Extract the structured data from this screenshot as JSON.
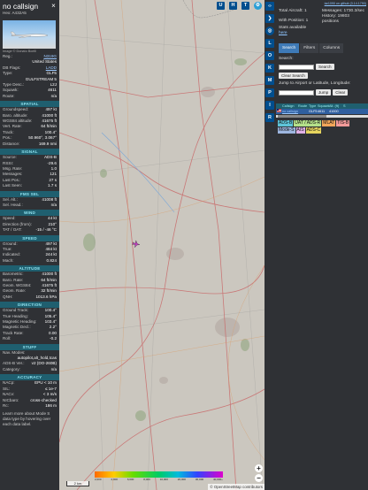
{
  "aircraft": {
    "callsign": "no callsign",
    "hex": "Hex: A432A5",
    "photo_credit": "Image © Donato Boelli",
    "details": [
      {
        "k": "Reg.:",
        "v": "N319G",
        "link": true
      },
      {
        "k": "",
        "v": "United States"
      },
      {
        "k": "DB Flags:",
        "v": "LADD",
        "link": true
      },
      {
        "k": "Type:",
        "v": "GLF5"
      },
      {
        "k": "",
        "v": "GULFSTREAM 5"
      },
      {
        "k": "Type Desc.:",
        "v": "L2J"
      },
      {
        "k": "Squawk:",
        "v": "4611"
      },
      {
        "k": "Route:",
        "v": "n/a"
      }
    ],
    "sections": [
      {
        "title": "SPATIAL",
        "rows": [
          {
            "k": "Groundspeed:",
            "v": "497 kt"
          },
          {
            "k": "Baro. altitude:",
            "v": "41000 ft"
          },
          {
            "k": "WGS84 altitude:",
            "v": "41675 ft"
          },
          {
            "k": "Vert. Rate:",
            "v": "64 ft/min"
          },
          {
            "k": "Track:",
            "v": "100.4°"
          },
          {
            "k": "Pos.:",
            "v": "50.960°, 3.067°"
          },
          {
            "k": "Distance:",
            "v": "169.9 nmi"
          }
        ]
      },
      {
        "title": "SIGNAL",
        "rows": [
          {
            "k": "Source:",
            "v": "ADS-B"
          },
          {
            "k": "RSSI:",
            "v": "-29.6"
          },
          {
            "k": "Msg. Rate:",
            "v": "1.0"
          },
          {
            "k": "Messages:",
            "v": "121"
          },
          {
            "k": "Last Pos.:",
            "v": "27 s"
          },
          {
            "k": "Last Seen:",
            "v": "1.7 s"
          }
        ]
      },
      {
        "title": "FMS SEL",
        "rows": [
          {
            "k": "Sel. Alt.:",
            "v": "41008 ft"
          },
          {
            "k": "Sel. Head.:",
            "v": "n/a"
          }
        ]
      },
      {
        "title": "WIND",
        "rows": [
          {
            "k": "Speed:",
            "v": "44 kt"
          },
          {
            "k": "Direction (from):",
            "v": "210°"
          },
          {
            "k": "TAT / OAT:",
            "v": "-15 / -46 °C"
          }
        ]
      },
      {
        "title": "SPEED",
        "rows": [
          {
            "k": "Ground:",
            "v": "497 kt"
          },
          {
            "k": "True:",
            "v": "484 kt"
          },
          {
            "k": "Indicated:",
            "v": "244 kt"
          },
          {
            "k": "Mach:",
            "v": "0.824"
          }
        ]
      },
      {
        "title": "ALTITUDE",
        "rows": [
          {
            "k": "Barometric:",
            "v": "41000 ft"
          },
          {
            "k": "Baro. Rate:",
            "v": "64 ft/min"
          },
          {
            "k": "Geom. WGS84:",
            "v": "41675 ft"
          },
          {
            "k": "Geom. Rate:",
            "v": "32 ft/min"
          },
          {
            "k": "QNH:",
            "v": "1013.6 hPa"
          }
        ]
      },
      {
        "title": "DIRECTION",
        "rows": [
          {
            "k": "Ground Track:",
            "v": "100.4°"
          },
          {
            "k": "True Heading:",
            "v": "105.4°"
          },
          {
            "k": "Magnetic Heading:",
            "v": "103.4°"
          },
          {
            "k": "Magnetic Decl.:",
            "v": "2.2°"
          },
          {
            "k": "Track Rate:",
            "v": "0.00"
          },
          {
            "k": "Roll:",
            "v": "-0.2"
          }
        ]
      },
      {
        "title": "STUFF",
        "rows": [
          {
            "k": "Nav. Modes:",
            "v": ""
          },
          {
            "k": "",
            "v": "autopilot,alt_hold,tcas"
          },
          {
            "k": "ADS-B Ver.:",
            "v": "v2 (DO-260B)"
          },
          {
            "k": "Category:",
            "v": "n/a"
          }
        ]
      },
      {
        "title": "ACCURACY",
        "rows": [
          {
            "k": "NACp:",
            "v": "EPU < 10 m"
          },
          {
            "k": "SIL:",
            "v": "≤ 1e-7"
          },
          {
            "k": "NACv:",
            "v": "< 3 m/s"
          },
          {
            "k": "NICbaro:",
            "v": "cross-checked"
          },
          {
            "k": "Rc:",
            "v": "186 m"
          }
        ]
      }
    ],
    "footer": "Learn more about Mode S data type by hovering over each data label."
  },
  "map": {
    "top_buttons": [
      "U",
      "H",
      "T"
    ],
    "zoom_in": "+",
    "zoom_out": "−",
    "scale": "2 km",
    "attribution": "© OpenStreetMap contributors",
    "alt_ticks": [
      "2,000",
      "4,000",
      "6,000",
      "8,000",
      "10,000",
      "20,000",
      "30,000",
      "40,000+"
    ]
  },
  "side_buttons": [
    "L",
    "O",
    "K",
    "M",
    "P",
    "I",
    "R"
  ],
  "panel": {
    "top_link": "tar1090 on github (3.14.1790)",
    "stats": {
      "total_aircraft": "Total Aircraft: 1",
      "with_position": "With Position: 1",
      "stats_available": "Stats available",
      "stats_link": "here",
      "messages": "Messages: 1730.3/sec",
      "history": "History: 19803 positions"
    },
    "tabs": [
      "Search",
      "Filters",
      "Columns"
    ],
    "search_label": "Search:",
    "search_button": "Search",
    "clear_search_button": "Clear Search",
    "jump_label": "Jump to Airport or Latitude, Longitude:",
    "jump_button": "Jump",
    "clear_button": "Clear",
    "table_headers": [
      "",
      "Callsign",
      "Route",
      "Type",
      "Squawk",
      "Alt. (ft)",
      "S"
    ],
    "table_row": [
      "",
      "no callsign",
      "",
      "GLF5",
      "4611",
      "41000",
      ""
    ],
    "legend": [
      {
        "label": "ADS-B",
        "color": "#5ec4d8"
      },
      {
        "label": "UAT / ADS-R",
        "color": "#b4e08a"
      },
      {
        "label": "MLAT",
        "color": "#f2a65a"
      },
      {
        "label": "TIS-B",
        "color": "#f29a9a"
      },
      {
        "label": "Mode-S",
        "color": "#9db6e0"
      },
      {
        "label": "AIS",
        "color": "#e0b0e6"
      },
      {
        "label": "ADS-C",
        "color": "#e6d45e"
      }
    ]
  }
}
